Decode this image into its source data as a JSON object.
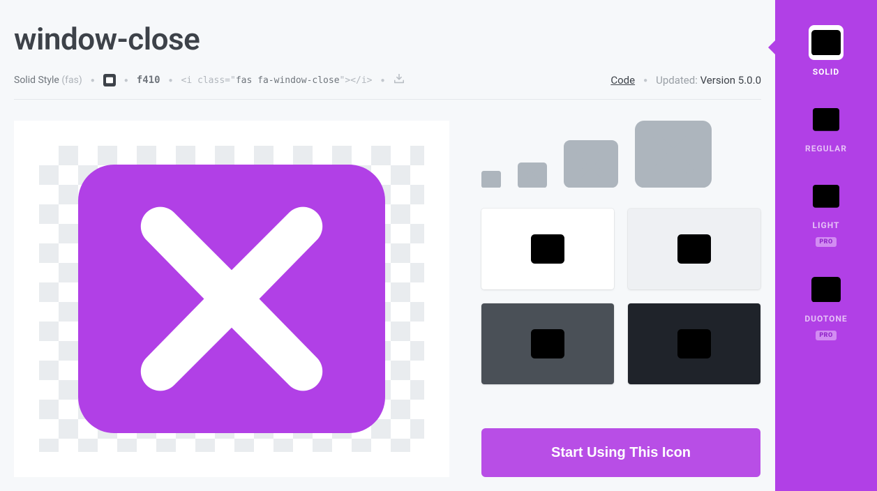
{
  "header": {
    "title": "window-close",
    "style_label": "Solid Style",
    "style_abbr": "(fas)",
    "unicode": "f410",
    "snippet_open": "<i class=\"",
    "snippet_class": "fas fa-window-close",
    "snippet_close": "\"></i>",
    "code_link": "Code",
    "updated_label": "Updated:",
    "updated_version": "Version 5.0.0"
  },
  "cta_label": "Start Using This Icon",
  "styles": {
    "solid": {
      "label": "SOLID"
    },
    "regular": {
      "label": "REGULAR"
    },
    "light": {
      "label": "LIGHT",
      "pro": "PRO"
    },
    "duotone": {
      "label": "DUOTONE",
      "pro": "PRO"
    }
  },
  "colors": {
    "accent": "#b140e6"
  }
}
